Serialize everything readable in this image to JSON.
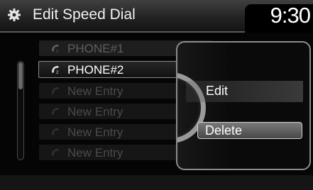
{
  "header": {
    "title": "Edit Speed Dial",
    "clock": "9:30",
    "icon": "gear-icon"
  },
  "list": {
    "items": [
      {
        "label": "PHONE#1",
        "icon": "phone-1-icon",
        "state": "normal"
      },
      {
        "label": "PHONE#2",
        "icon": "phone-2-icon",
        "state": "selected"
      },
      {
        "label": "New Entry",
        "icon": "phone-icon",
        "state": "dim"
      },
      {
        "label": "New Entry",
        "icon": "phone-icon",
        "state": "dim"
      },
      {
        "label": "New Entry",
        "icon": "phone-icon",
        "state": "dim"
      },
      {
        "label": "New Entry",
        "icon": "phone-icon",
        "state": "dim"
      }
    ]
  },
  "popup": {
    "options": [
      {
        "label": "Edit"
      },
      {
        "label": "Delete",
        "highlighted": true
      }
    ]
  }
}
